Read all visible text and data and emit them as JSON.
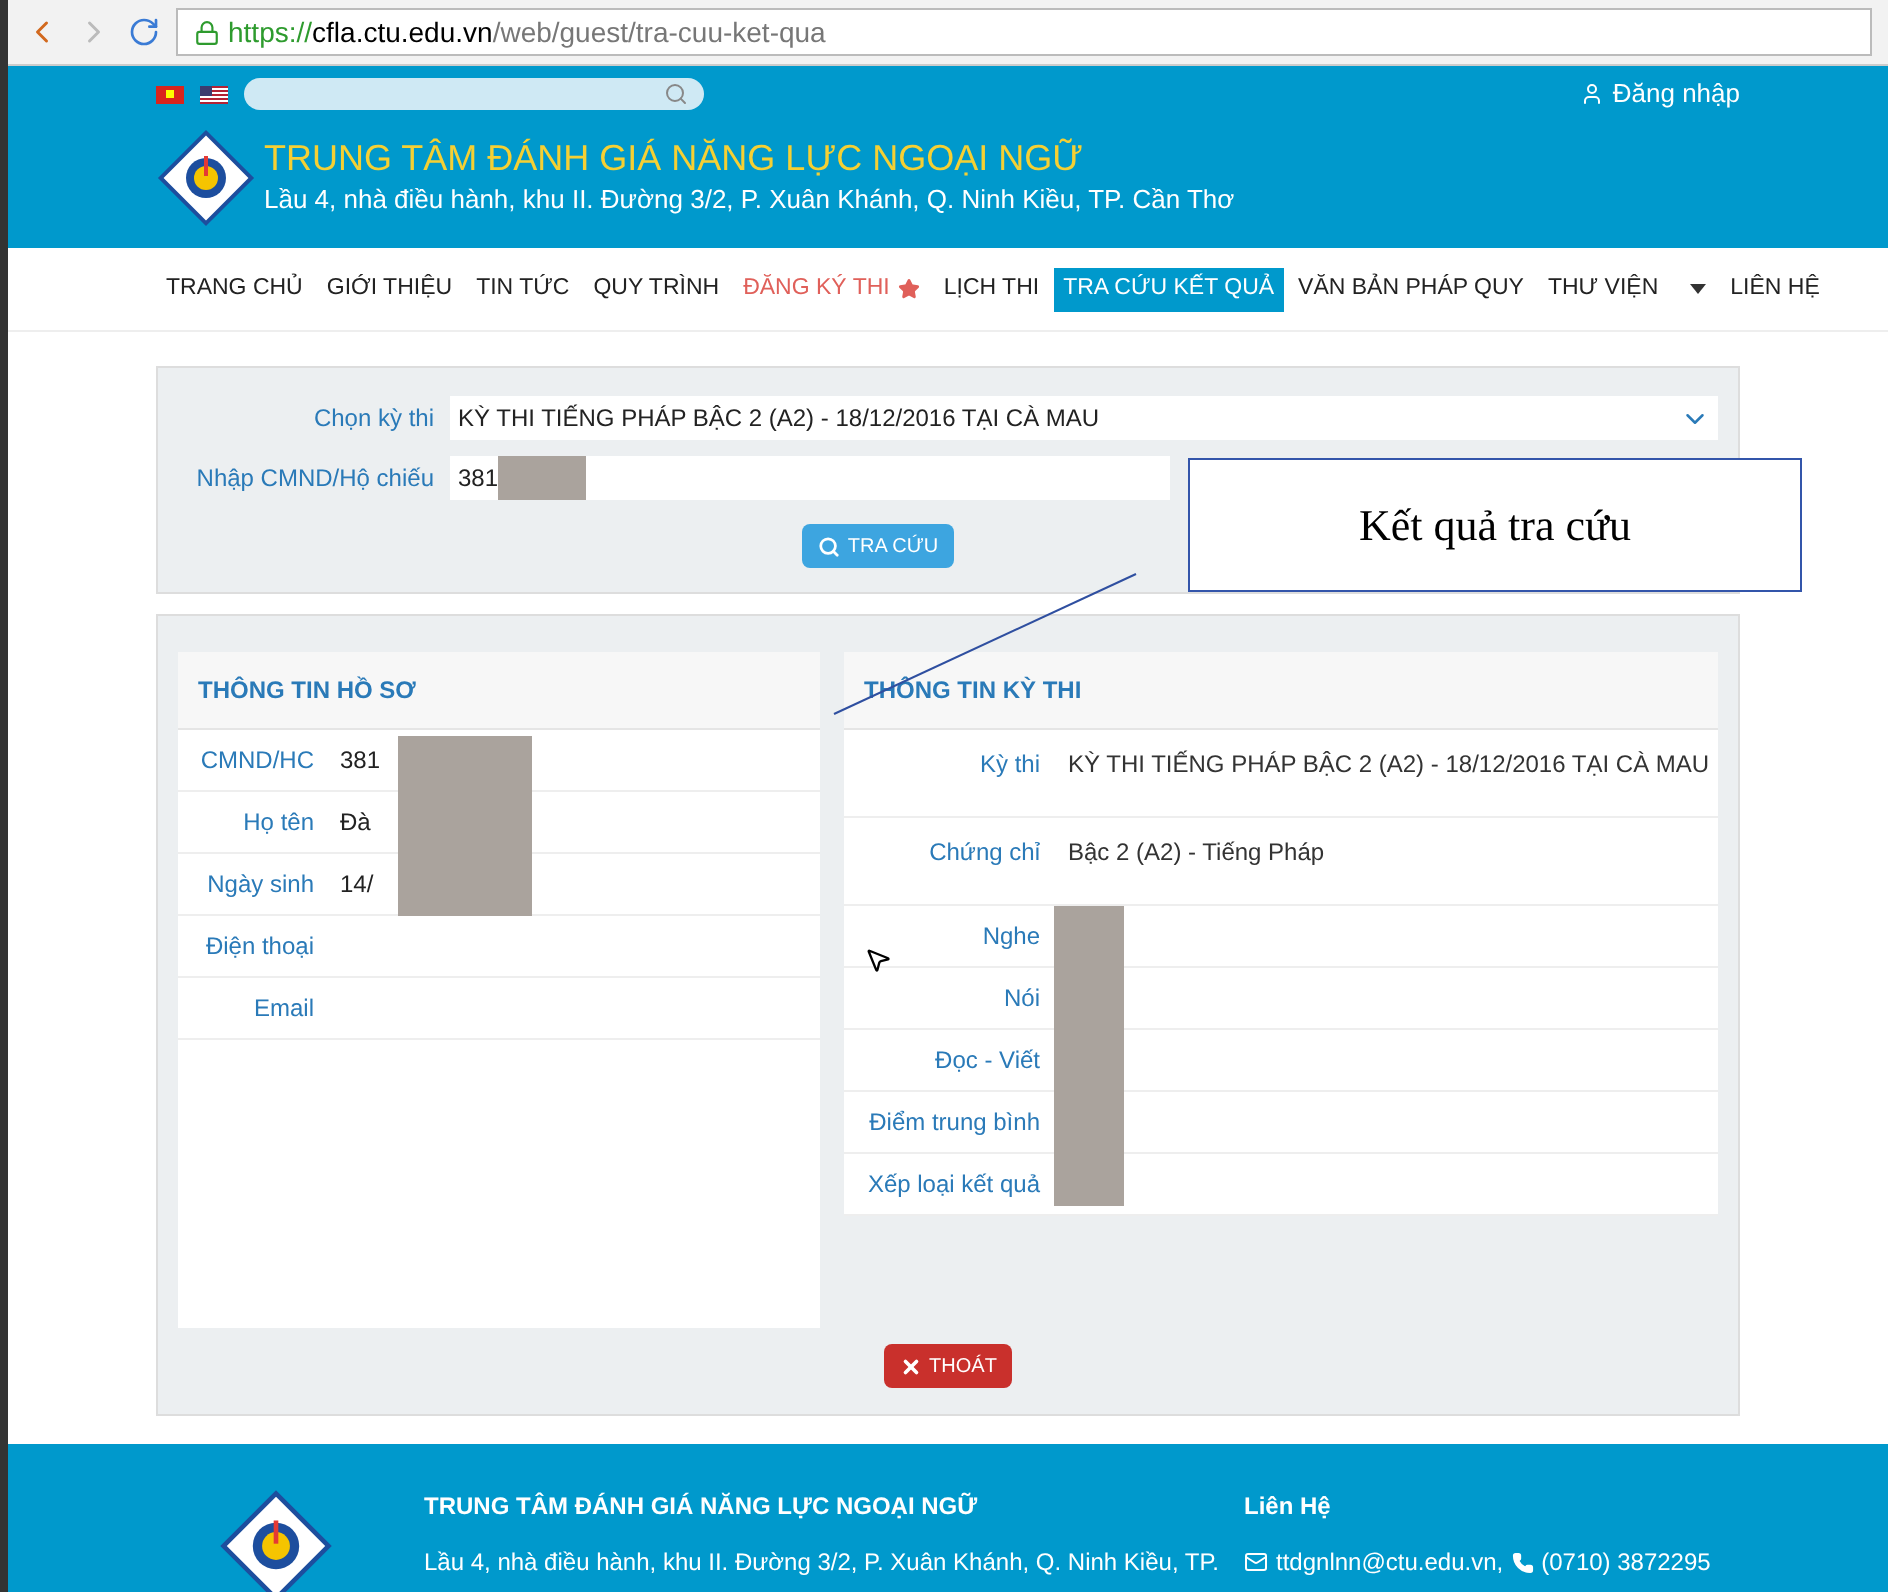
{
  "browser": {
    "url_scheme": "https://",
    "url_host": "cfla.ctu.edu.vn",
    "url_path": "/web/guest/tra-cuu-ket-qua"
  },
  "header": {
    "login": "Đăng nhập",
    "title": "TRUNG TÂM ĐÁNH GIÁ NĂNG LỰC NGOẠI NGỮ",
    "address": "Lầu 4, nhà điều hành, khu II. Đường 3/2, P. Xuân Khánh, Q. Ninh Kiều, TP. Cần Thơ"
  },
  "nav": [
    {
      "label": "TRANG CHỦ",
      "selected": false,
      "kind": "plain"
    },
    {
      "label": "GIỚI THIỆU",
      "selected": false,
      "kind": "plain"
    },
    {
      "label": "TIN TỨC",
      "selected": false,
      "kind": "plain"
    },
    {
      "label": "QUY TRÌNH",
      "selected": false,
      "kind": "plain"
    },
    {
      "label": "ĐĂNG KÝ THI",
      "selected": false,
      "kind": "star"
    },
    {
      "label": "LỊCH THI",
      "selected": false,
      "kind": "plain"
    },
    {
      "label": "TRA CỨU KẾT QUẢ",
      "selected": true,
      "kind": "plain"
    },
    {
      "label": "VĂN BẢN PHÁP QUY",
      "selected": false,
      "kind": "plain"
    },
    {
      "label": "THƯ VIỆN",
      "selected": false,
      "kind": "dropdown"
    },
    {
      "label": "LIÊN HỆ",
      "selected": false,
      "kind": "plain"
    }
  ],
  "search_form": {
    "exam_label": "Chọn kỳ thi",
    "exam_value": "KỲ THI TIẾNG PHÁP BẬC 2 (A2) - 18/12/2016 TẠI CÀ MAU",
    "id_label": "Nhập CMND/Hộ chiếu",
    "id_value": "381",
    "button": "TRA CỨU"
  },
  "callout": "Kết quả tra cứu",
  "profile": {
    "title": "THÔNG TIN HỒ SƠ",
    "rows": [
      {
        "label": "CMND/HC",
        "value": "381"
      },
      {
        "label": "Họ tên",
        "value": "Đà"
      },
      {
        "label": "Ngày sinh",
        "value": "14/"
      },
      {
        "label": "Điện thoại"
      },
      {
        "label": "Email"
      }
    ]
  },
  "exam": {
    "title": "THÔNG TIN KỲ THI",
    "rows": [
      {
        "label": "Kỳ thi",
        "value": "KỲ THI TIẾNG PHÁP BẬC 2 (A2) - 18/12/2016 TẠI CÀ MAU"
      },
      {
        "label": "Chứng chỉ",
        "value": "Bậc 2 (A2) - Tiếng Pháp"
      },
      {
        "label": "Nghe"
      },
      {
        "label": "Nói"
      },
      {
        "label": "Đọc - Viết"
      },
      {
        "label": "Điểm trung bình"
      },
      {
        "label": "Xếp loại kết quả"
      }
    ]
  },
  "exit_button": "THOÁT",
  "footer": {
    "title": "TRUNG TÂM ĐÁNH GIÁ NĂNG LỰC NGOẠI NGỮ",
    "address": "Lầu 4, nhà điều hành, khu II. Đường 3/2, P. Xuân Khánh, Q. Ninh Kiều, TP.",
    "contact_title": "Liên Hệ",
    "email": "ttdgnlnn@ctu.edu.vn,",
    "phone": "(0710) 3872295"
  }
}
